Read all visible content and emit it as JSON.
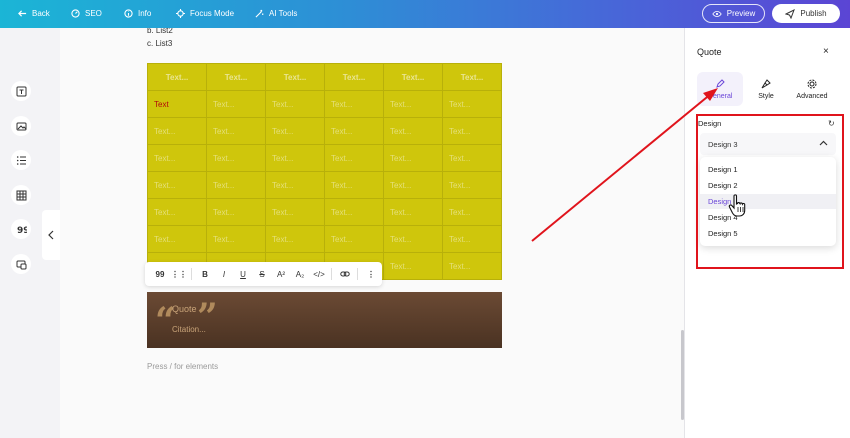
{
  "topbar": {
    "back": "Back",
    "seo": "SEO",
    "info": "Info",
    "focus_mode": "Focus Mode",
    "ai_tools": "AI Tools",
    "preview": "Preview",
    "publish": "Publish"
  },
  "editor": {
    "list_item_b": "b. List2",
    "list_item_c": "c. List3",
    "table": {
      "header": [
        "Text...",
        "Text...",
        "Text...",
        "Text...",
        "Text...",
        "Text..."
      ],
      "first_cell": "Text",
      "placeholder": "Text..."
    },
    "format_bar": {
      "quote": "99",
      "bold": "B",
      "italic": "I",
      "underline": "U",
      "strike": "S",
      "superscript": "A²",
      "subscript": "A₂",
      "code": "</>"
    },
    "quote_block": {
      "label": "Quote",
      "citation": "Citation..."
    },
    "placeholder": "Press / for elements"
  },
  "panel": {
    "title": "Quote",
    "close": "×",
    "tabs": [
      "General",
      "Style",
      "Advanced"
    ],
    "active_tab": "General",
    "design_label": "Design",
    "selected_design": "Design 3",
    "options": [
      "Design 1",
      "Design 2",
      "Design 3",
      "Design 4",
      "Design 5"
    ],
    "highlighted_option": "Design 3"
  },
  "colors": {
    "accent": "#6a46d8",
    "table_bg": "#cfc60c",
    "annotation": "#e0141c"
  }
}
